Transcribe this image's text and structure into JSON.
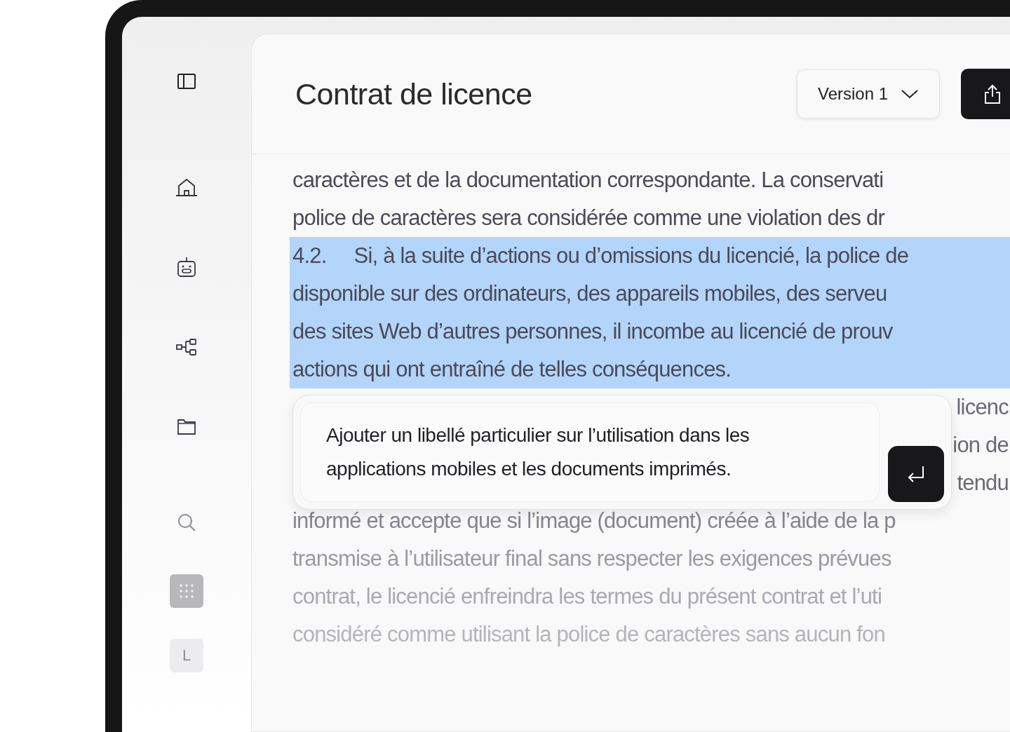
{
  "sidebar": {
    "items": [
      {
        "kind": "panel"
      },
      {
        "kind": "home"
      },
      {
        "kind": "robot"
      },
      {
        "kind": "flow"
      },
      {
        "kind": "folder"
      },
      {
        "kind": "search"
      },
      {
        "kind": "grid"
      }
    ],
    "avatar": "L"
  },
  "header": {
    "title": "Contrat de licence",
    "version": "Version 1"
  },
  "document": {
    "lines": [
      {
        "text": "caractères et de la documentation correspondante. La conservati",
        "highlighted": false,
        "kind": "full"
      },
      {
        "text": "police de caractères sera considérée comme une violation des dr",
        "highlighted": false,
        "kind": "full"
      },
      {
        "text": "4.2.     Si, à la suite d’actions ou d’omissions du licencié, la police de",
        "highlighted": true,
        "kind": "full"
      },
      {
        "text": "disponible sur des ordinateurs, des appareils mobiles, des serveu",
        "highlighted": true,
        "kind": "full"
      },
      {
        "text": "des sites Web d’autres personnes, il incombe au licencié de prouv",
        "highlighted": true,
        "kind": "full"
      },
      {
        "text": "actions qui ont entraîné de telles conséquences.",
        "highlighted": true,
        "kind": "full"
      },
      {
        "text": "licenc",
        "highlighted": false,
        "kind": "partial"
      },
      {
        "text": "ion de",
        "highlighted": false,
        "kind": "partial"
      },
      {
        "text": "tendu",
        "highlighted": false,
        "kind": "partial"
      },
      {
        "text": "informé et accepte que si l’image (document) créée à l’aide de la p",
        "highlighted": false,
        "kind": "full"
      },
      {
        "text": "transmise à l’utilisateur final sans respecter les exigences prévues",
        "highlighted": false,
        "kind": "full"
      },
      {
        "text": "contrat, le licencié enfreindra les termes du présent contrat et l’uti",
        "highlighted": false,
        "kind": "full"
      },
      {
        "text": "considéré comme utilisant la police de caractères sans aucun fon",
        "highlighted": false,
        "kind": "full"
      }
    ]
  },
  "prompt": {
    "value": "Ajouter un libellé particulier sur l’utilisation dans les applications mobiles et les documents imprimés."
  }
}
